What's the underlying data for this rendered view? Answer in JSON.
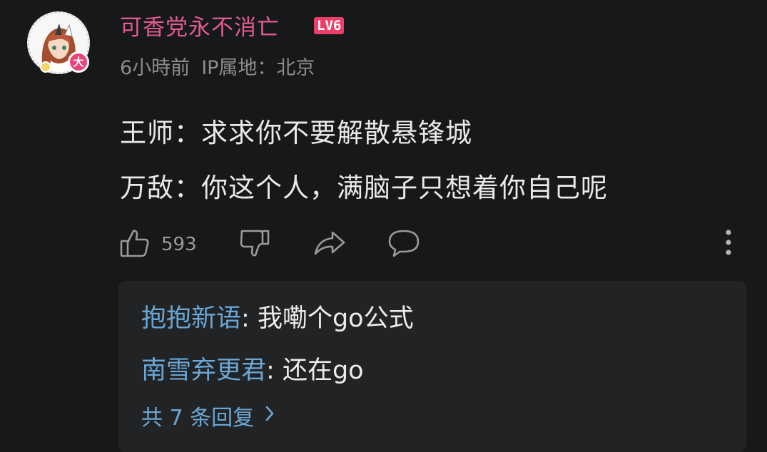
{
  "comment": {
    "username": "可香党永不消亡",
    "level_badge": "LV6",
    "avatar_badge": "大",
    "time": "6小時前",
    "ip_location": "IP属地：北京",
    "lines": [
      "王师：求求你不要解散悬锋城",
      "万敌：你这个人，满脑子只想着你自己呢"
    ],
    "like_count": "593"
  },
  "replies": {
    "items": [
      {
        "author": "抱抱新语",
        "separator": ": ",
        "text": "我嘞个go公式"
      },
      {
        "author": "南雪弃更君",
        "separator": ": ",
        "text": "还在go"
      }
    ],
    "more_label": "共 7 条回复"
  },
  "icons": {
    "like": "thumbs-up-icon",
    "dislike": "thumbs-down-icon",
    "share": "share-icon",
    "comment": "comment-icon",
    "more": "more-vertical-icon",
    "chevron": "chevron-right-icon"
  },
  "colors": {
    "background": "#17181a",
    "username": "#e05b8e",
    "level_badge": "#ee3f68",
    "reply_author": "#6aa7d6",
    "reply_box": "#222325",
    "meta_text": "#8c8c8c"
  }
}
